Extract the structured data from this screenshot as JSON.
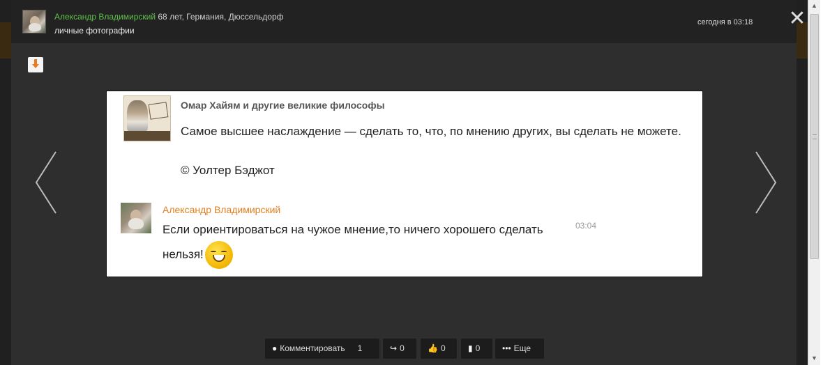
{
  "header": {
    "author_name": "Александр Владимирский",
    "author_meta": " 68 лет, Германия, Дюссельдорф",
    "album": "личные фотографии",
    "timestamp": "сегодня в 03:18",
    "close_icon": "close-icon"
  },
  "photo": {
    "group_title": "Омар Хайям и другие великие философы",
    "quote": "Самое высшее наслаждение — сделать то, что, по мнению других, вы сделать не можете.",
    "quote_author": "© Уолтер Бэджот",
    "comment": {
      "author": "Александр Владимирский",
      "text": "Если ориентироваться на чужое мнение,то ничего хорошего сделать нельзя!",
      "time": "03:04"
    }
  },
  "actions": {
    "comment_label": "Комментировать",
    "comment_count": "1",
    "share_count": "0",
    "like_count": "0",
    "stats_count": "0",
    "more_label": "Еще"
  },
  "icons": {
    "download": "download-icon",
    "prev": "chevron-left-icon",
    "next": "chevron-right-icon",
    "comment": "speech-bubble-icon",
    "share": "share-arrow-icon",
    "like": "thumbs-up-icon",
    "stats": "bar-chart-icon",
    "more": "ellipsis-icon",
    "emoji": "smiley-icon"
  },
  "colors": {
    "author_link": "#5fc04b",
    "commenter_name": "#e07f1f",
    "accent_orange": "#ee7b1e"
  }
}
